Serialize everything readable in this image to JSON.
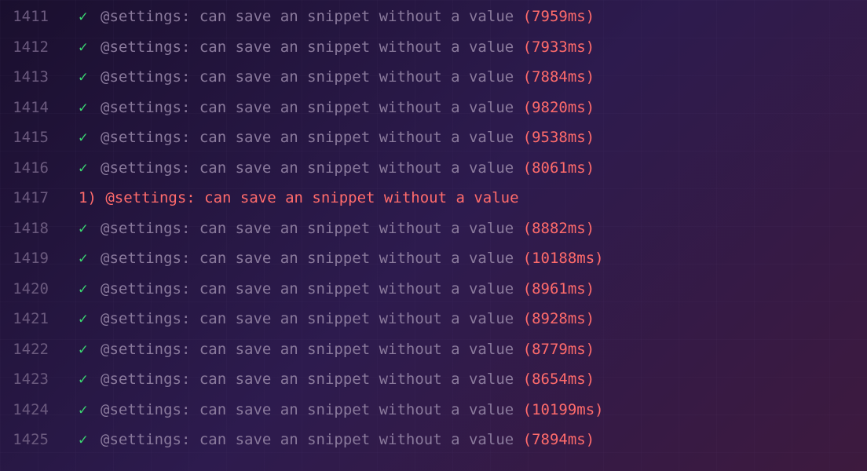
{
  "lines": [
    {
      "number": "1411",
      "status": "pass",
      "mark": "✓",
      "text": "@settings: can save an snippet without a value",
      "timing": "(7959ms)"
    },
    {
      "number": "1412",
      "status": "pass",
      "mark": "✓",
      "text": "@settings: can save an snippet without a value",
      "timing": "(7933ms)"
    },
    {
      "number": "1413",
      "status": "pass",
      "mark": "✓",
      "text": "@settings: can save an snippet without a value",
      "timing": "(7884ms)"
    },
    {
      "number": "1414",
      "status": "pass",
      "mark": "✓",
      "text": "@settings: can save an snippet without a value",
      "timing": "(9820ms)"
    },
    {
      "number": "1415",
      "status": "pass",
      "mark": "✓",
      "text": "@settings: can save an snippet without a value",
      "timing": "(9538ms)"
    },
    {
      "number": "1416",
      "status": "pass",
      "mark": "✓",
      "text": "@settings: can save an snippet without a value",
      "timing": "(8061ms)"
    },
    {
      "number": "1417",
      "status": "fail",
      "mark": "1)",
      "text": "@settings: can save an snippet without a value",
      "timing": ""
    },
    {
      "number": "1418",
      "status": "pass",
      "mark": "✓",
      "text": "@settings: can save an snippet without a value",
      "timing": "(8882ms)"
    },
    {
      "number": "1419",
      "status": "pass",
      "mark": "✓",
      "text": "@settings: can save an snippet without a value",
      "timing": "(10188ms)"
    },
    {
      "number": "1420",
      "status": "pass",
      "mark": "✓",
      "text": "@settings: can save an snippet without a value",
      "timing": "(8961ms)"
    },
    {
      "number": "1421",
      "status": "pass",
      "mark": "✓",
      "text": "@settings: can save an snippet without a value",
      "timing": "(8928ms)"
    },
    {
      "number": "1422",
      "status": "pass",
      "mark": "✓",
      "text": "@settings: can save an snippet without a value",
      "timing": "(8779ms)"
    },
    {
      "number": "1423",
      "status": "pass",
      "mark": "✓",
      "text": "@settings: can save an snippet without a value",
      "timing": "(8654ms)"
    },
    {
      "number": "1424",
      "status": "pass",
      "mark": "✓",
      "text": "@settings: can save an snippet without a value",
      "timing": "(10199ms)"
    },
    {
      "number": "1425",
      "status": "pass",
      "mark": "✓",
      "text": "@settings: can save an snippet without a value",
      "timing": "(7894ms)"
    }
  ]
}
